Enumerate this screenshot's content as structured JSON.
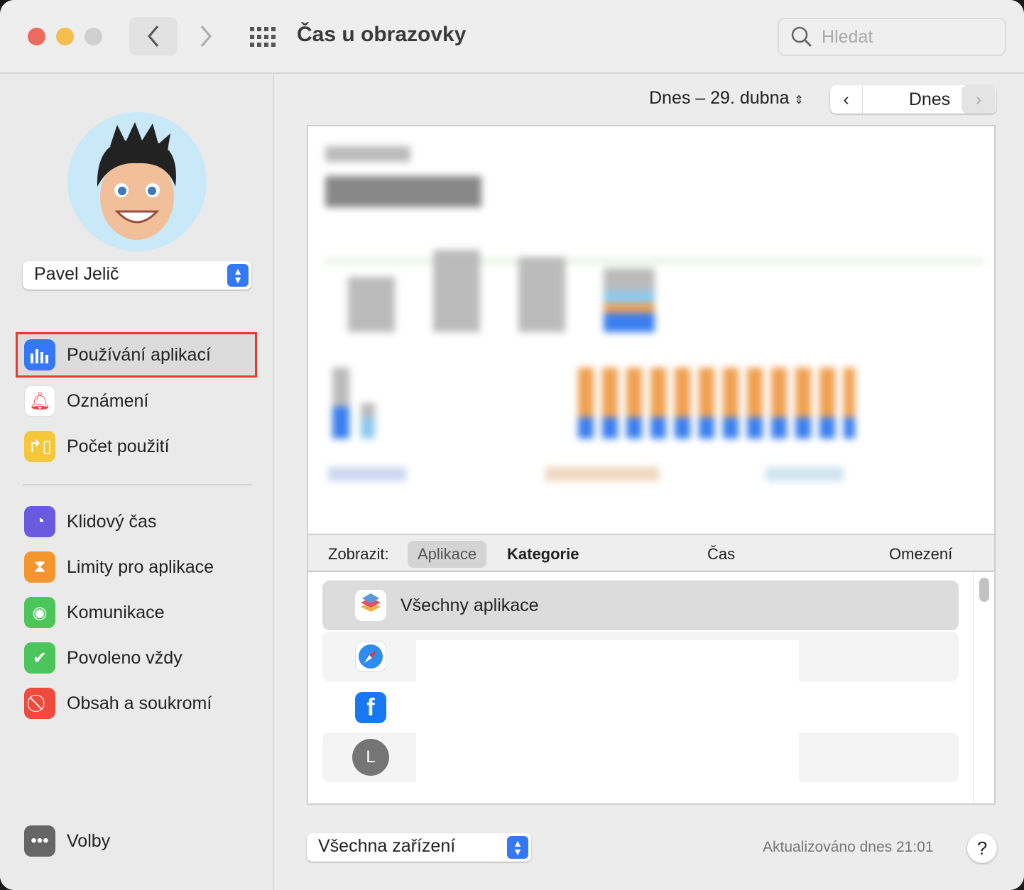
{
  "window": {
    "title": "Čas u obrazovky"
  },
  "search": {
    "placeholder": "Hledat"
  },
  "sidebar": {
    "user": "Pavel Jelič",
    "items": [
      {
        "label": "Používání aplikací",
        "icon": "bar-chart-icon",
        "color": "#3478f6"
      },
      {
        "label": "Oznámení",
        "icon": "bell-icon",
        "color": "#ffffff"
      },
      {
        "label": "Počet použití",
        "icon": "pickup-icon",
        "color": "#f5c83c"
      },
      {
        "label": "Klidový čas",
        "icon": "downtime-icon",
        "color": "#6a5ae0"
      },
      {
        "label": "Limity pro aplikace",
        "icon": "hourglass-icon",
        "color": "#f5952e"
      },
      {
        "label": "Komunikace",
        "icon": "contact-icon",
        "color": "#4cc55a"
      },
      {
        "label": "Povoleno vždy",
        "icon": "checkmark-badge-icon",
        "color": "#4cc55a"
      },
      {
        "label": "Obsah a soukromí",
        "icon": "prohibited-icon",
        "color": "#ef4a3e"
      }
    ],
    "options": "Volby"
  },
  "main": {
    "date": "Dnes – 29. dubna",
    "today": "Dnes",
    "toolbar": {
      "show": "Zobrazit:",
      "apps": "Aplikace",
      "categories": "Kategorie",
      "time": "Čas",
      "limits": "Omezení"
    },
    "list": [
      {
        "name": "Všechny aplikace",
        "icon": "all-apps-icon"
      },
      {
        "icon": "safari-icon"
      },
      {
        "icon": "facebook-icon"
      },
      {
        "icon": "letter-avatar-icon",
        "letter": "L"
      }
    ],
    "devices": "Všechna zařízení",
    "updated": "Aktualizováno dnes 21:01",
    "help": "?"
  }
}
